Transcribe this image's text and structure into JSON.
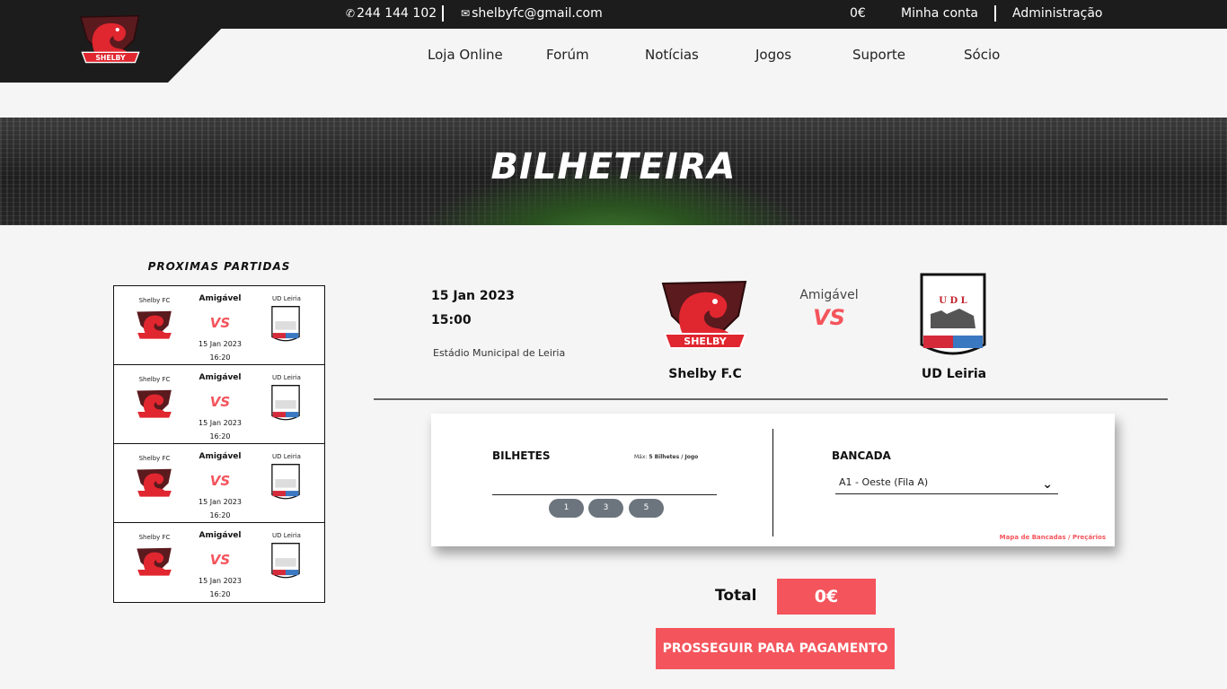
{
  "topbar": {
    "phone": "244 144 102",
    "email": "shelbyfc@gmail.com",
    "cart_total": "0€",
    "account": "Minha conta",
    "admin": "Administração"
  },
  "logo": {
    "text": "SHELBY"
  },
  "nav": [
    "Loja Online",
    "Forúm",
    "Notícias",
    "Jogos",
    "Suporte",
    "Sócio"
  ],
  "hero": {
    "title": "BILHETEIRA"
  },
  "upcoming": {
    "title": "PROXIMAS  PARTIDAS",
    "matches": [
      {
        "home": "Shelby FC",
        "away": "UD Leiria",
        "competition": "Amigável",
        "vs": "VS",
        "date": "15 Jan 2023",
        "time": "16:20"
      },
      {
        "home": "Shelby FC",
        "away": "UD Leiria",
        "competition": "Amigável",
        "vs": "VS",
        "date": "15 Jan 2023",
        "time": "16:20"
      },
      {
        "home": "Shelby FC",
        "away": "UD Leiria",
        "competition": "Amigável",
        "vs": "VS",
        "date": "15 Jan 2023",
        "time": "16:20"
      },
      {
        "home": "Shelby FC",
        "away": "UD Leiria",
        "competition": "Amigável",
        "vs": "VS",
        "date": "15 Jan 2023",
        "time": "16:20"
      }
    ]
  },
  "match": {
    "date": "15 Jan 2023",
    "time": "15:00",
    "venue": "Estádio Municipal de Leiria",
    "home": "Shelby F.C",
    "away": "UD Leiria",
    "competition": "Amigável",
    "vs": "VS",
    "away_logo_text": "U D L"
  },
  "tickets": {
    "label": "BILHETES",
    "max_prefix": "Máx: ",
    "max_value": "5 Bilhetes / Jogo",
    "quantity_value": "",
    "quick_qty": [
      "1",
      "3",
      "5"
    ],
    "stand_label": "BANCADA",
    "stand_selected": "A1 - Oeste (Fila A)",
    "map_link": "Mapa de Bancadas / Preçários"
  },
  "total": {
    "label": "Total",
    "value": "0€"
  },
  "checkout": {
    "button": "PROSSEGUIR PARA PAGAMENTO"
  },
  "colors": {
    "accent": "#f4545c",
    "dark": "#1c1c1c",
    "pill": "#6c757d"
  }
}
